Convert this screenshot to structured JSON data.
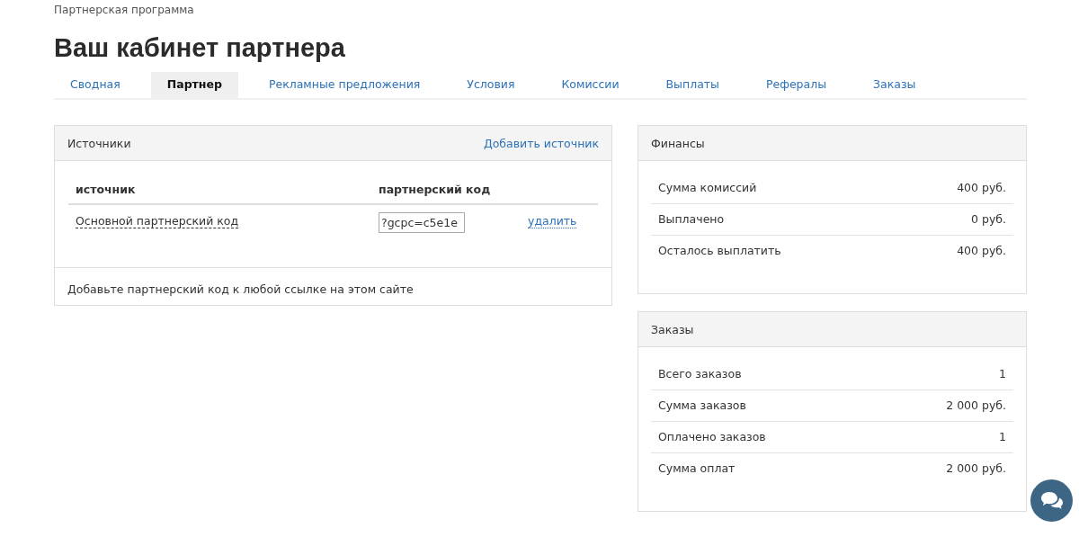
{
  "breadcrumb": "Партнерская программа",
  "title": "Ваш кабинет партнера",
  "tabs": [
    {
      "label": "Сводная",
      "selected": false
    },
    {
      "label": "Партнер",
      "selected": true
    },
    {
      "label": "Рекламные предложения",
      "selected": false
    },
    {
      "label": "Условия",
      "selected": false
    },
    {
      "label": "Комиссии",
      "selected": false
    },
    {
      "label": "Выплаты",
      "selected": false
    },
    {
      "label": "Рефералы",
      "selected": false
    },
    {
      "label": "Заказы",
      "selected": false
    }
  ],
  "sources": {
    "title": "Источники",
    "add_link": "Добавить источник",
    "columns": [
      "источник",
      "партнерский код"
    ],
    "rows": [
      {
        "name": "Основной партнерский код",
        "code": "?gcpc=c5e1e",
        "action": "удалить"
      }
    ],
    "footer": "Добавьте партнерский код к любой ссылке на этом сайте"
  },
  "finances": {
    "title": "Финансы",
    "rows": [
      {
        "label": "Сумма комиссий",
        "value": "400 руб."
      },
      {
        "label": "Выплачено",
        "value": "0 руб."
      },
      {
        "label": "Осталось выплатить",
        "value": "400 руб."
      }
    ]
  },
  "orders": {
    "title": "Заказы",
    "rows": [
      {
        "label": "Всего заказов",
        "value": "1"
      },
      {
        "label": "Сумма заказов",
        "value": "2 000 руб."
      },
      {
        "label": "Оплачено заказов",
        "value": "1"
      },
      {
        "label": "Сумма оплат",
        "value": "2 000 руб."
      }
    ]
  }
}
